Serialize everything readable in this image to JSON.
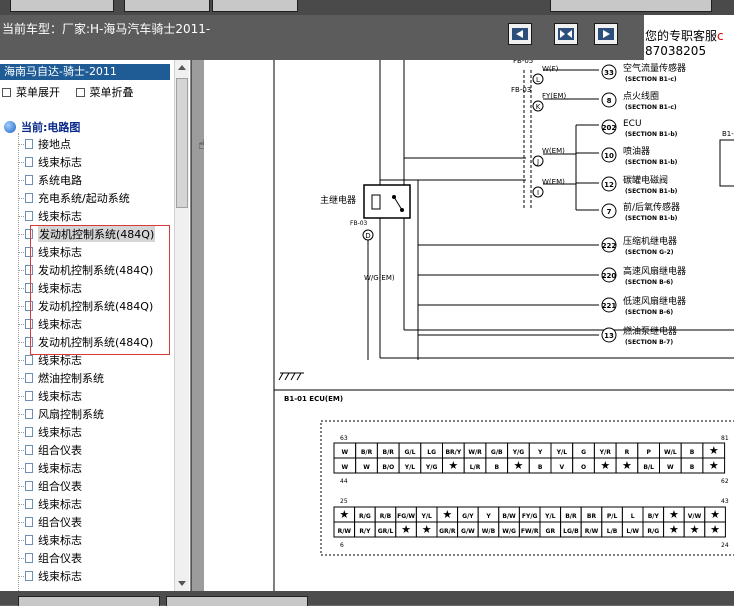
{
  "header": {
    "model_title": "当前车型：厂家:H-海马汽车骑士2011-",
    "nav_buttons": [
      {
        "name": "nav-left-button",
        "icon": "arrow-left-right-icon"
      },
      {
        "name": "nav-center-button",
        "icon": "arrows-inward-icon"
      },
      {
        "name": "nav-right-button",
        "icon": "arrow-right-left-icon"
      }
    ],
    "service_line1": "您的专职客服",
    "service_line2": "87038205",
    "service_cut": "c"
  },
  "tree": {
    "panel_title": "海南马自达-骑士-2011",
    "expand_all": "菜单展开",
    "collapse_all": "菜单折叠",
    "root_label": "当前:电路图",
    "items": [
      {
        "label": "接地点"
      },
      {
        "label": "线束标志"
      },
      {
        "label": "系统电路"
      },
      {
        "label": "充电系统/起动系统"
      },
      {
        "label": "线束标志"
      },
      {
        "label": "发动机控制系统(484Q)",
        "selected": true
      },
      {
        "label": "线束标志"
      },
      {
        "label": "发动机控制系统(484Q)"
      },
      {
        "label": "线束标志"
      },
      {
        "label": "发动机控制系统(484Q)"
      },
      {
        "label": "线束标志"
      },
      {
        "label": "发动机控制系统(484Q)"
      },
      {
        "label": "线束标志"
      },
      {
        "label": "燃油控制系统"
      },
      {
        "label": "线束标志"
      },
      {
        "label": "风扇控制系统"
      },
      {
        "label": "线束标志"
      },
      {
        "label": "组合仪表"
      },
      {
        "label": "线束标志"
      },
      {
        "label": "组合仪表"
      },
      {
        "label": "线束标志"
      },
      {
        "label": "组合仪表"
      },
      {
        "label": "线束标志"
      },
      {
        "label": "组合仪表"
      },
      {
        "label": "线束标志"
      }
    ]
  },
  "diagram": {
    "relay_label": "主继电器",
    "relay_conn": "FB-03",
    "relay_pin": "D",
    "relay_wire": "W/G(EM)",
    "top_conn": "FB-05",
    "mid_conn": "FB-03",
    "wires": [
      {
        "pin": "L",
        "color": "W(F)"
      },
      {
        "pin": "K",
        "color": "FY(EM)"
      },
      {
        "pin": "J",
        "color": "W(EM)"
      },
      {
        "pin": "I",
        "color": "W(EM)"
      }
    ],
    "components": [
      {
        "num": "33",
        "name": "空气流量传感器",
        "section": "(SECTION B1-c)"
      },
      {
        "num": "8",
        "name": "点火线圈",
        "section": "(SECTION B1-c)"
      },
      {
        "num": "202",
        "name": "ECU",
        "section": "(SECTION B1-b)"
      },
      {
        "num": "10",
        "name": "喷油器",
        "section": "(SECTION B1-b)"
      },
      {
        "num": "12",
        "name": "碳罐电磁阀",
        "section": "(SECTION B1-b)"
      },
      {
        "num": "7",
        "name": "前/后氧传感器",
        "section": "(SECTION B1-b)"
      },
      {
        "num": "222",
        "name": "压缩机继电器",
        "section": "(SECTION G-2)"
      },
      {
        "num": "220",
        "name": "高速风扇继电器",
        "section": "(SECTION B-6)"
      },
      {
        "num": "221",
        "name": "低速风扇继电器",
        "section": "(SECTION B-6)"
      },
      {
        "num": "13",
        "name": "燃油泵继电器",
        "section": "(SECTION B-7)"
      }
    ],
    "partial_label": "B1-",
    "ecu_title": "B1-01   ECU(EM)",
    "connector": {
      "upper_left_top": "63",
      "upper_right_top": "81",
      "upper_left_bottom": "44",
      "upper_right_bottom": "62",
      "lower_left_top": "25",
      "lower_right_top": "43",
      "lower_left_bottom": "6",
      "lower_right_bottom": "24",
      "row1": [
        "W",
        "B/R",
        "B/R",
        "G/L",
        "LG",
        "BR/Y",
        "W/R",
        "G/B",
        "Y/G",
        "Y",
        "Y/L",
        "G",
        "Y/R",
        "R",
        "P",
        "W/L",
        "B",
        "★"
      ],
      "row2": [
        "W",
        "W",
        "B/O",
        "Y/L",
        "Y/G",
        "★",
        "L/R",
        "B",
        "★",
        "B",
        "V",
        "O",
        "★",
        "★",
        "B/L",
        "W",
        "B",
        "★"
      ],
      "row3": [
        "★",
        "R/G",
        "R/B",
        "FG/W",
        "Y/L",
        "★",
        "G/Y",
        "Y",
        "B/W",
        "FY/G",
        "Y/L",
        "B/R",
        "BR",
        "P/L",
        "L",
        "B/Y",
        "★",
        "V/W",
        "★"
      ],
      "row4": [
        "R/W",
        "R/Y",
        "GR/L",
        "★",
        "★",
        "GR/R",
        "G/W",
        "W/B",
        "W/G",
        "FW/R",
        "GR",
        "LG/B",
        "R/W",
        "L/B",
        "L/W",
        "R/G",
        "★",
        "★",
        "★"
      ]
    }
  },
  "colors": {
    "header_bg": "#5c5c5c",
    "panel_header_bg": "#1f5c96",
    "highlight_border": "#d83a3a",
    "tree_root_text": "#0a2a8a"
  }
}
